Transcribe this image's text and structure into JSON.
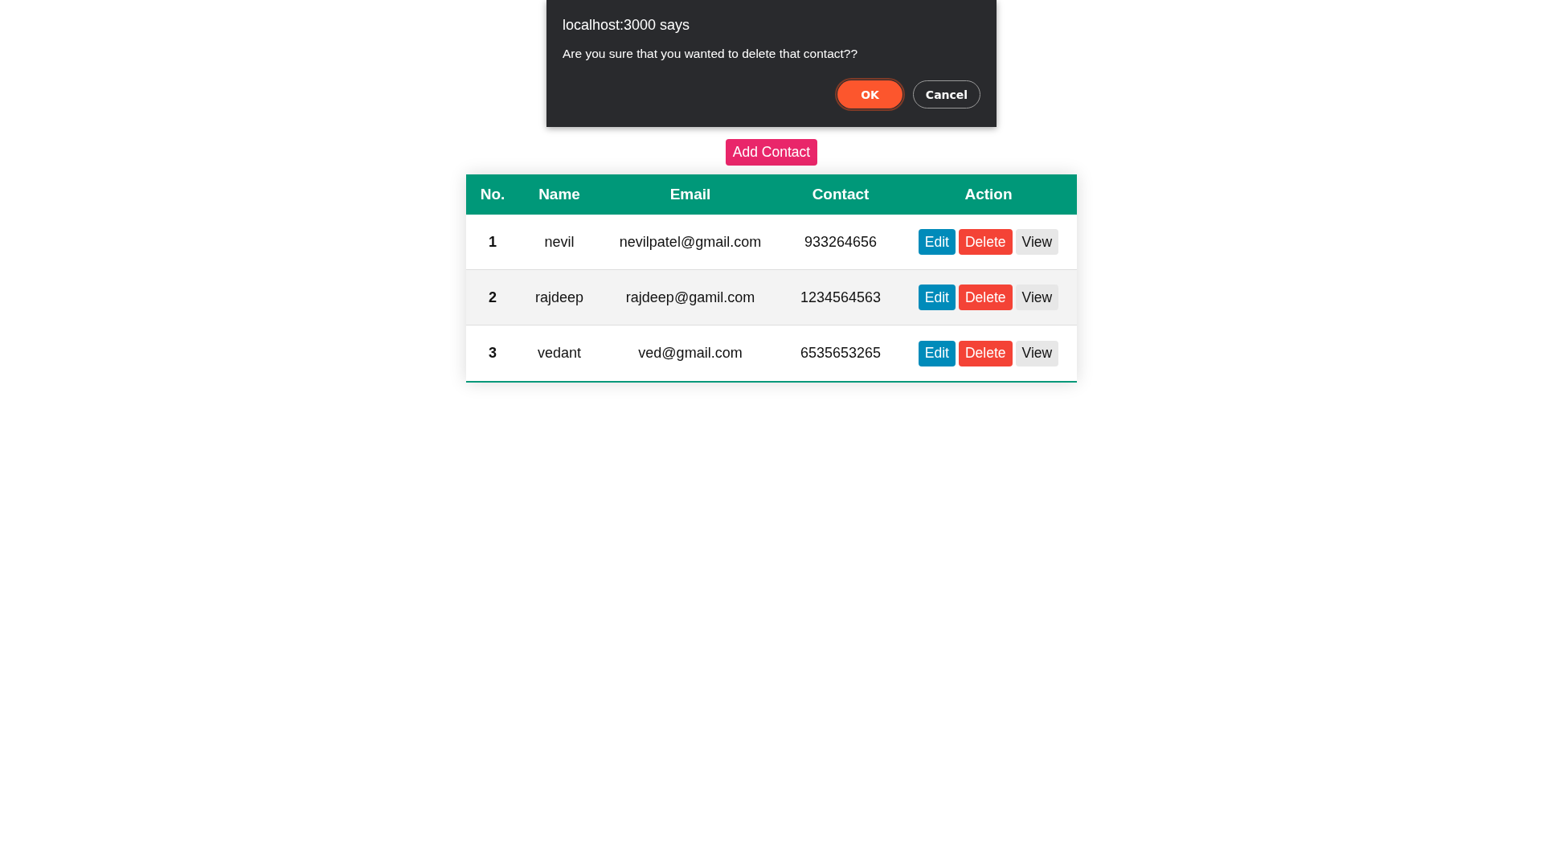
{
  "dialog": {
    "title": "localhost:3000 says",
    "message": "Are you sure that you wanted to delete that contact??",
    "buttons": [
      {
        "label": "OK",
        "kind": "primary",
        "focused": true
      },
      {
        "label": "Cancel",
        "kind": "secondary",
        "focused": false
      }
    ]
  },
  "add_button": {
    "label": "Add Contact"
  },
  "table": {
    "columns": [
      "No.",
      "Name",
      "Email",
      "Contact",
      "Action"
    ],
    "rows": [
      {
        "no": "1",
        "name": "nevil",
        "email": "nevilpatel@gmail.com",
        "contact": "933264656",
        "actions": [
          {
            "label": "Edit",
            "kind": "edit"
          },
          {
            "label": "Delete",
            "kind": "delete"
          },
          {
            "label": "View",
            "kind": "view"
          }
        ]
      },
      {
        "no": "2",
        "name": "rajdeep",
        "email": "rajdeep@gamil.com",
        "contact": "1234564563",
        "actions": [
          {
            "label": "Edit",
            "kind": "edit"
          },
          {
            "label": "Delete",
            "kind": "delete"
          },
          {
            "label": "View",
            "kind": "view"
          }
        ]
      },
      {
        "no": "3",
        "name": "vedant",
        "email": "ved@gmail.com",
        "contact": "6535653265",
        "actions": [
          {
            "label": "Edit",
            "kind": "edit"
          },
          {
            "label": "Delete",
            "kind": "delete"
          },
          {
            "label": "View",
            "kind": "view"
          }
        ]
      }
    ]
  }
}
